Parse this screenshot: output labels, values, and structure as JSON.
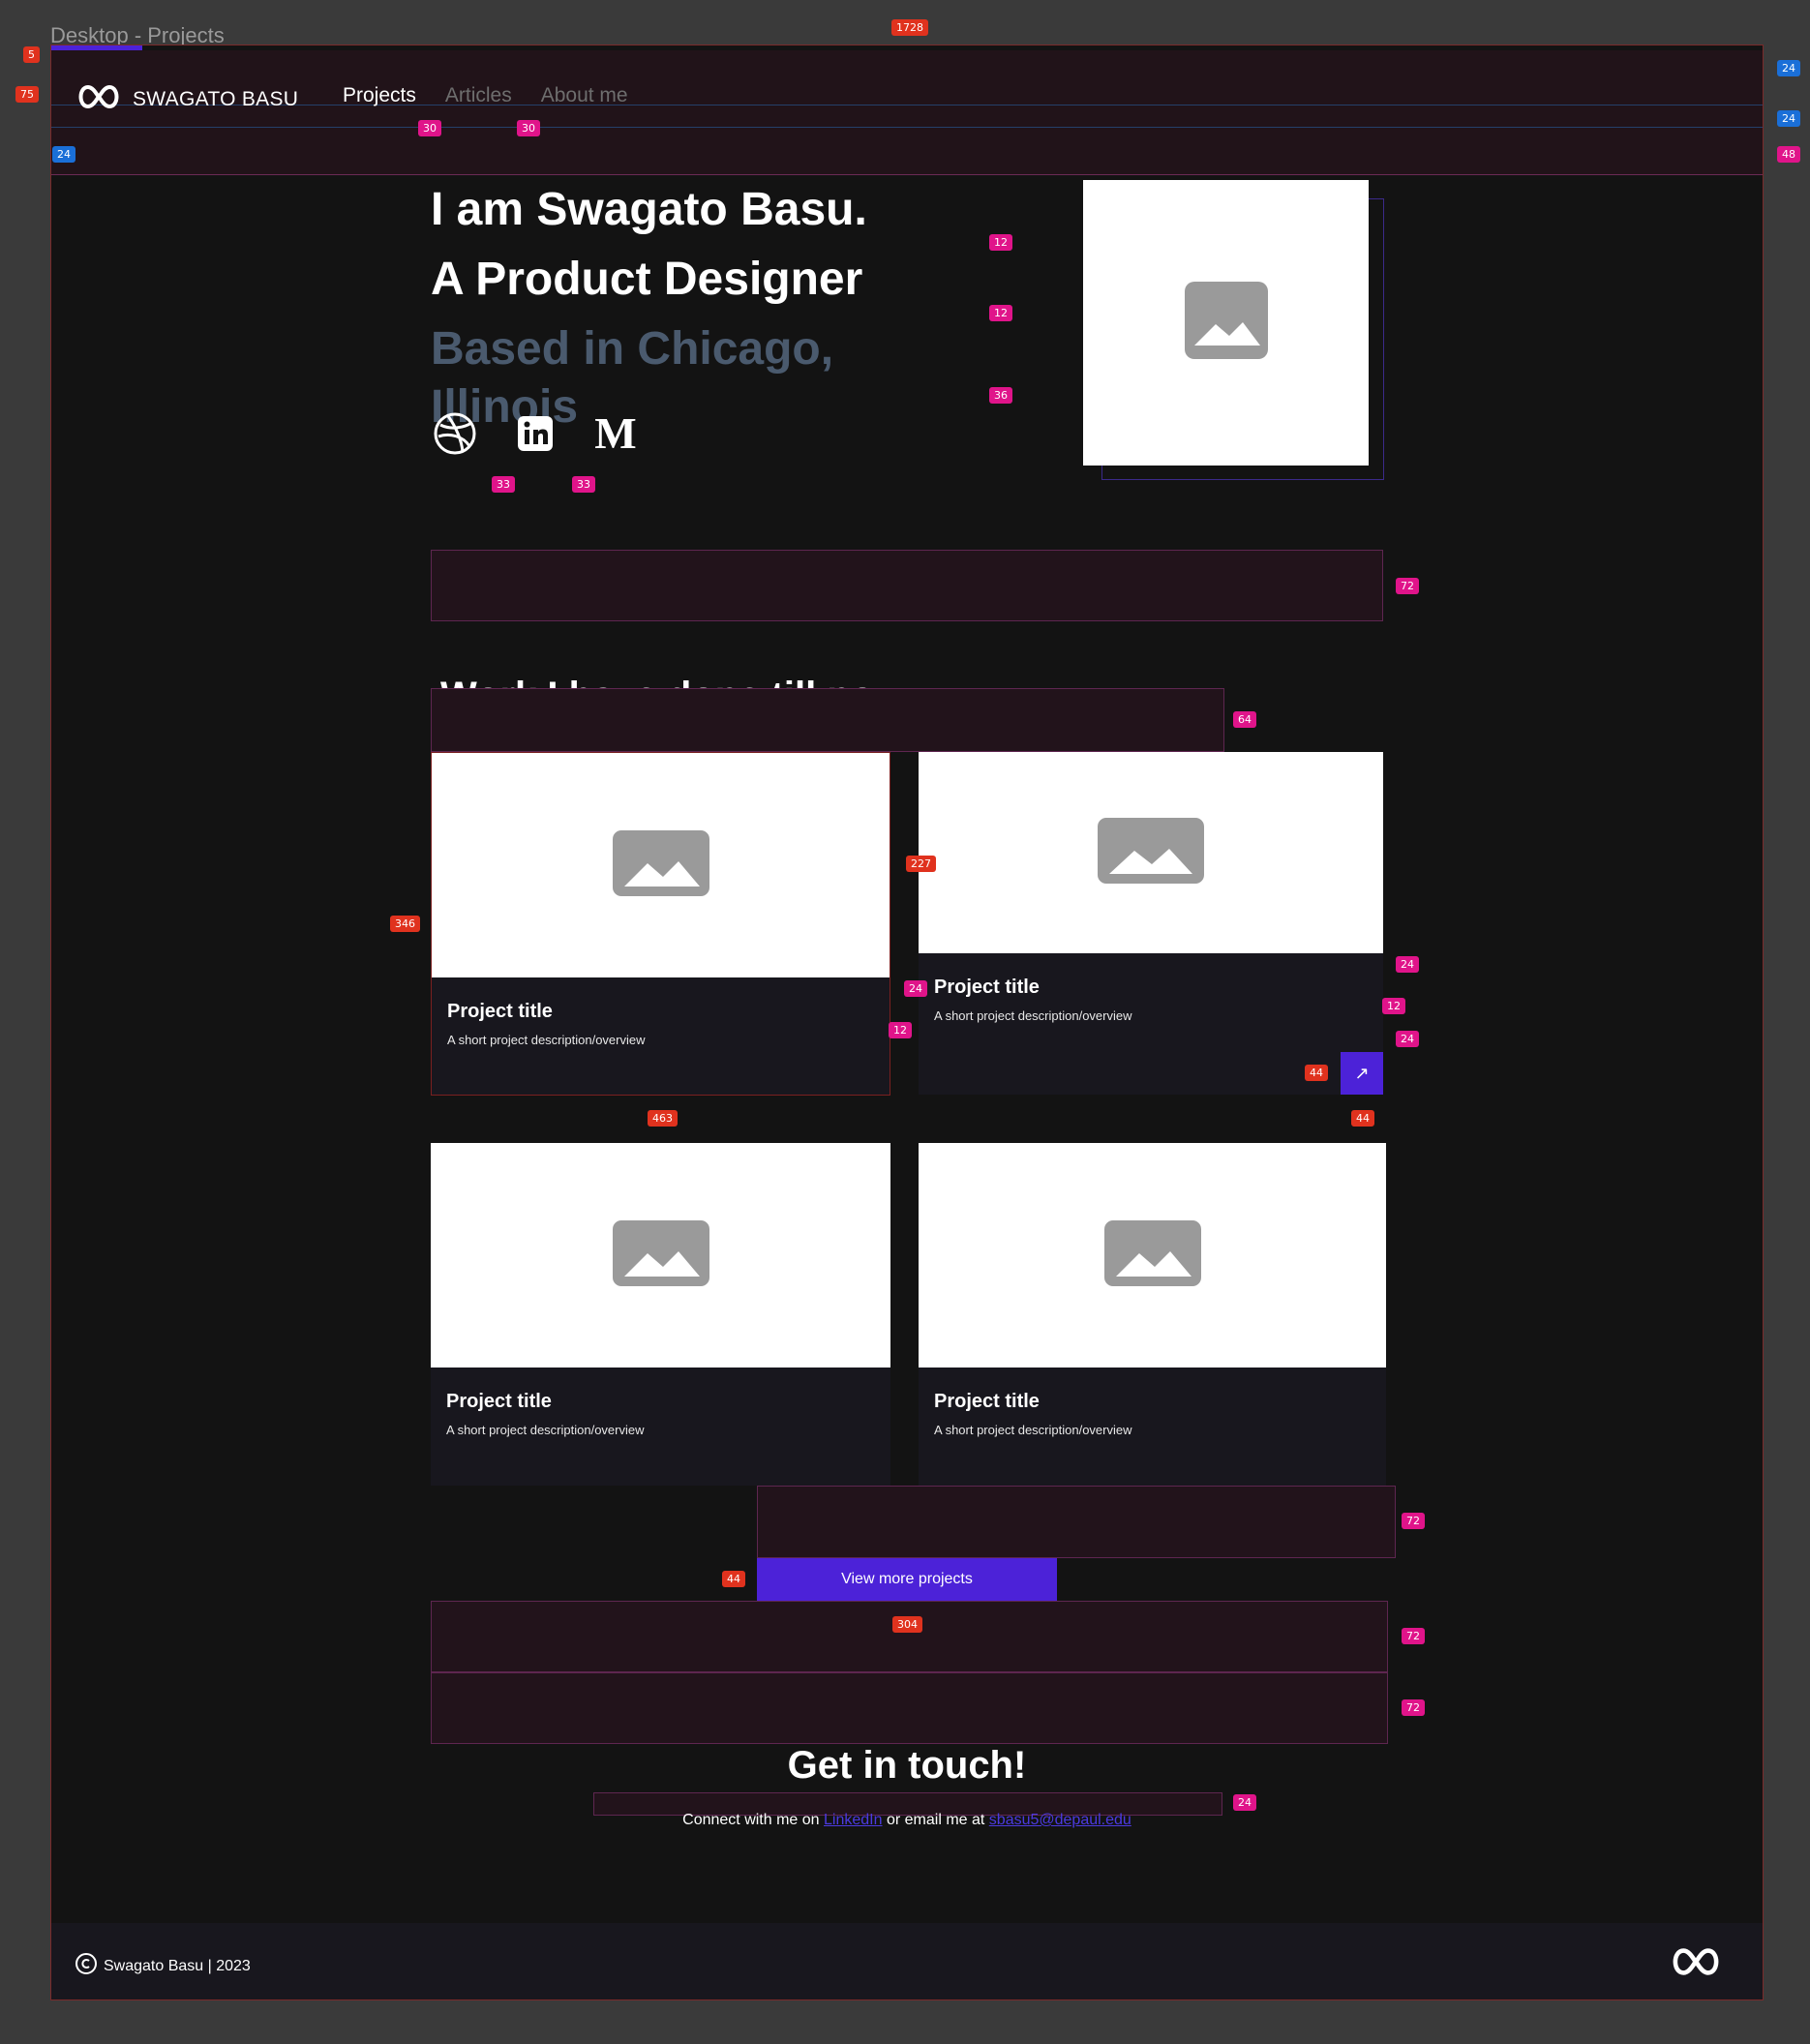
{
  "frame": {
    "title": "Desktop - Projects"
  },
  "nav": {
    "brand": "SWAGATO BASU",
    "links": [
      {
        "label": "Projects",
        "active": true
      },
      {
        "label": "Articles",
        "active": false
      },
      {
        "label": "About me",
        "active": false
      }
    ]
  },
  "hero": {
    "line1": "I am Swagato Basu.",
    "line2": "A Product Designer",
    "line3": "Based in Chicago, Illinois",
    "socials": [
      "dribbble-icon",
      "linkedin-icon",
      "medium-icon"
    ],
    "medium_glyph": "M"
  },
  "work": {
    "heading": "Work I have done till now",
    "cards": [
      {
        "title": "Project title",
        "desc": "A short project description/overview"
      },
      {
        "title": "Project title",
        "desc": "A short project description/overview",
        "arrow": "↗"
      },
      {
        "title": "Project title",
        "desc": "A short project description/overview"
      },
      {
        "title": "Project title",
        "desc": "A short project description/overview"
      }
    ],
    "view_more": "View more projects"
  },
  "contact": {
    "heading": "Get in touch!",
    "prefix": "Connect with me on",
    "linkedin": "LinkedIn",
    "middle": "or email me at",
    "email": "sbasu5@depaul.edu"
  },
  "footer": {
    "copyright_symbol": "©",
    "text": "Swagato Basu | 2023"
  },
  "annotations": {
    "frame_width": "1728",
    "t5": "5",
    "t75": "75",
    "t24a": "24",
    "t24b": "24",
    "t24c": "24",
    "t48": "48",
    "t30a": "30",
    "t30b": "30",
    "t12a": "12",
    "t12b": "12",
    "t36": "36",
    "t33a": "33",
    "t33b": "33",
    "t72a": "72",
    "t64": "64",
    "t346": "346",
    "t227": "227",
    "t24d": "24",
    "t12c": "12",
    "t24e": "24",
    "t12d": "12",
    "t24f": "24",
    "t44a": "44",
    "t463": "463",
    "t44b": "44",
    "t72b": "72",
    "t44c": "44",
    "t304": "304",
    "t72c": "72",
    "t72d": "72",
    "t24g": "24"
  },
  "colors": {
    "accent": "#4c22d8",
    "background": "#131313",
    "card": "#18171e",
    "muted_heading": "#4a5a6e"
  }
}
